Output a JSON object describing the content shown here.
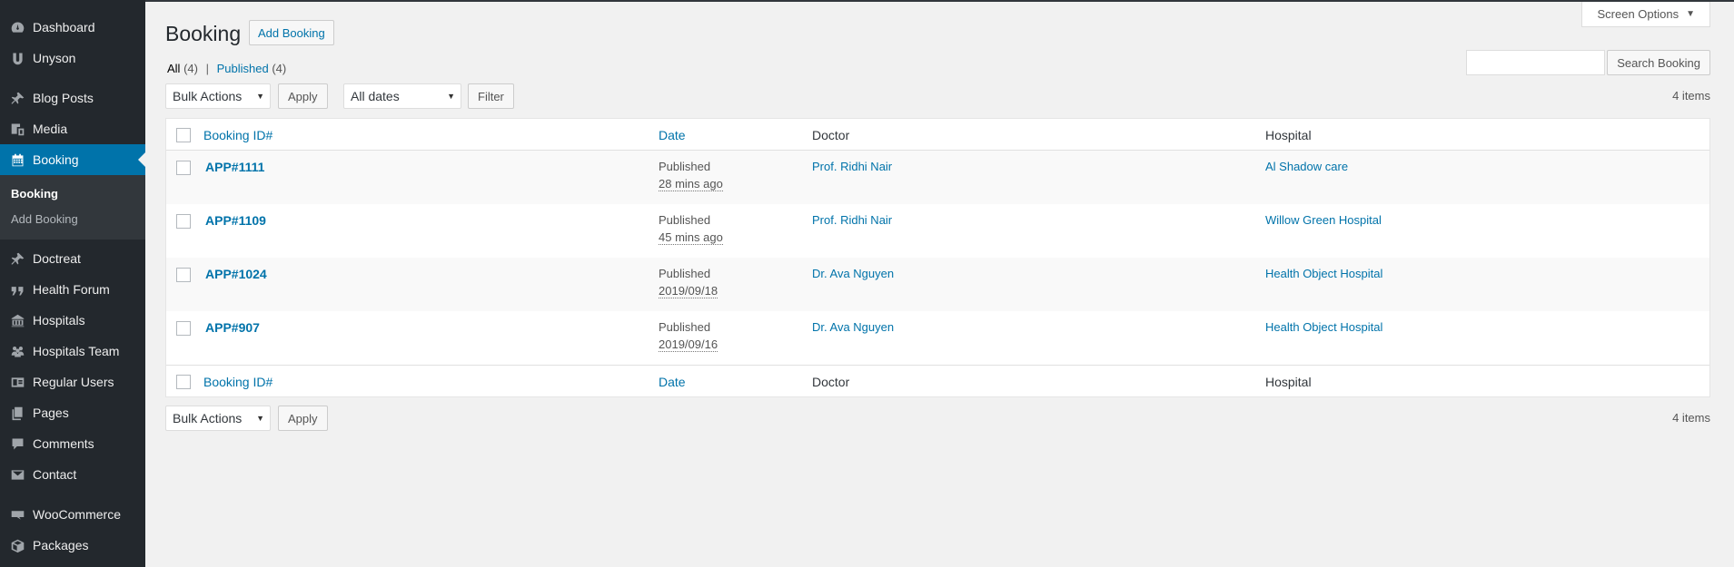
{
  "sidebar": {
    "items": [
      {
        "label": "Dashboard",
        "icon": "dashboard-icon"
      },
      {
        "label": "Unyson",
        "icon": "unyson-icon"
      },
      {
        "label": "Blog Posts",
        "icon": "pin-icon"
      },
      {
        "label": "Media",
        "icon": "media-icon"
      },
      {
        "label": "Booking",
        "icon": "calendar-icon"
      },
      {
        "label": "Doctreat",
        "icon": "pin-icon"
      },
      {
        "label": "Health Forum",
        "icon": "quote-icon"
      },
      {
        "label": "Hospitals",
        "icon": "building-icon"
      },
      {
        "label": "Hospitals Team",
        "icon": "groups-icon"
      },
      {
        "label": "Regular Users",
        "icon": "id-card-icon"
      },
      {
        "label": "Pages",
        "icon": "pages-icon"
      },
      {
        "label": "Comments",
        "icon": "comment-icon"
      },
      {
        "label": "Contact",
        "icon": "mail-icon"
      },
      {
        "label": "WooCommerce",
        "icon": "woo-icon"
      },
      {
        "label": "Packages",
        "icon": "box-icon"
      }
    ],
    "submenu": [
      "Booking",
      "Add Booking"
    ]
  },
  "header": {
    "screen_options": "Screen Options",
    "title": "Booking",
    "add_new": "Add Booking"
  },
  "filters": {
    "all_label": "All",
    "all_count": "(4)",
    "separator": "|",
    "published_label": "Published",
    "published_count": "(4)",
    "search_button": "Search Booking",
    "bulk_actions": "Bulk Actions",
    "apply": "Apply",
    "all_dates": "All dates",
    "filter": "Filter",
    "items_count": "4 items"
  },
  "table": {
    "columns": {
      "id": "Booking ID#",
      "date": "Date",
      "doctor": "Doctor",
      "hospital": "Hospital"
    },
    "rows": [
      {
        "id": "APP#1111",
        "status": "Published",
        "time": "28 mins ago",
        "doctor": "Prof. Ridhi Nair",
        "hospital": "Al Shadow care"
      },
      {
        "id": "APP#1109",
        "status": "Published",
        "time": "45 mins ago",
        "doctor": "Prof. Ridhi Nair",
        "hospital": "Willow Green Hospital"
      },
      {
        "id": "APP#1024",
        "status": "Published",
        "time": "2019/09/18",
        "doctor": "Dr. Ava Nguyen",
        "hospital": "Health Object Hospital"
      },
      {
        "id": "APP#907",
        "status": "Published",
        "time": "2019/09/16",
        "doctor": "Dr. Ava Nguyen",
        "hospital": "Health Object Hospital"
      }
    ]
  },
  "colors": {
    "sidebar_bg": "#23282d",
    "accent": "#0073aa",
    "page_bg": "#f1f1f1"
  }
}
